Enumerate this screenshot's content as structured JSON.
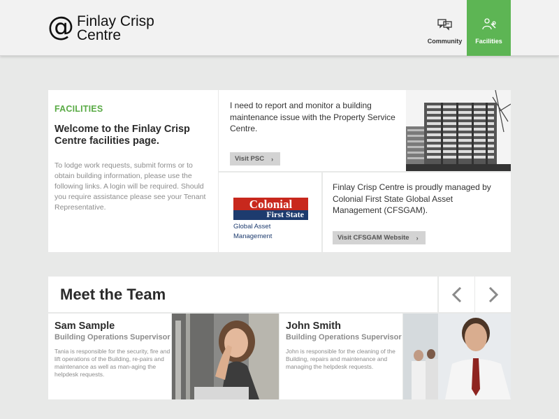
{
  "header": {
    "logo_symbol": "@",
    "logo_line1": "Finlay Crisp",
    "logo_line2": "Centre",
    "nav": [
      {
        "label": "Community",
        "icon": "chat-bubbles-icon",
        "active": false
      },
      {
        "label": "Facilities",
        "icon": "person-wrench-icon",
        "active": true
      }
    ]
  },
  "facilities": {
    "eyebrow": "FACILITIES",
    "welcome": "Welcome to the Finlay Crisp Centre facilities page.",
    "intro": "To lodge work requests, submit forms or to obtain building information, please use the following links. A login will be required. Should you require assistance please see your Tenant Representative.",
    "psc_text": "I need to report and monitor a building maintenance issue with the Property Service Centre.",
    "psc_button": "Visit PSC",
    "cfs_logo_line1": "Colonial",
    "cfs_logo_line2": "First State",
    "cfs_logo_line3": "Global Asset Management",
    "cfs_text": "Finlay Crisp Centre is proudly managed by Colonial First State Global Asset Management (CFSGAM).",
    "cfs_button": "Visit CFSGAM Website"
  },
  "team": {
    "title": "Meet the Team",
    "members": [
      {
        "name": "Sam Sample",
        "role": "Building Operations Supervisor",
        "bio": "Tania is responsible for the security, fire and lift operations of the Building, re-pairs and maintenance as well as man-aging the helpdesk requests."
      },
      {
        "name": "John Smith",
        "role": "Building Operations Supervisor",
        "bio": "John is responsible for the cleaning of the Building, repairs and maintenance and managing the helpdesk requests."
      }
    ]
  },
  "colors": {
    "accent_green": "#5db554",
    "eyebrow_green": "#5aab46",
    "background": "#e8e9e8",
    "cfs_red": "#c8281d",
    "cfs_navy": "#1d3b6e"
  }
}
